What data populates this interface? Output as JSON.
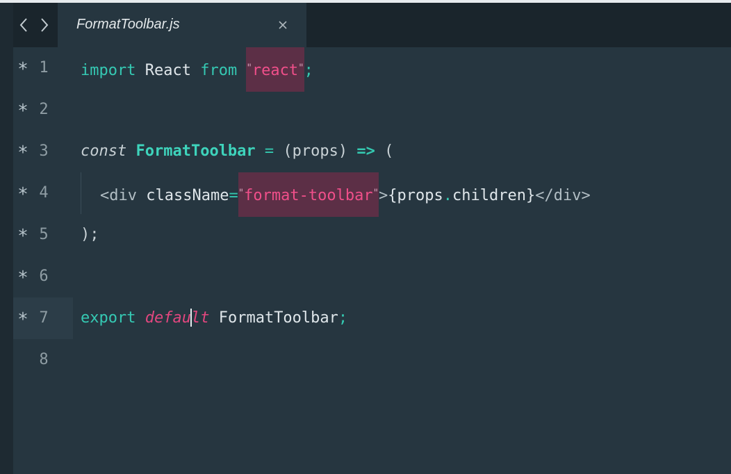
{
  "tab": {
    "title": "FormatToolbar.js"
  },
  "nav": {
    "back_icon": "chevron-left-icon",
    "forward_icon": "chevron-right-icon",
    "close_icon": "close-icon"
  },
  "modified_marker": "*",
  "lines": [
    {
      "number": "1",
      "modified": true
    },
    {
      "number": "2",
      "modified": true
    },
    {
      "number": "3",
      "modified": true
    },
    {
      "number": "4",
      "modified": true
    },
    {
      "number": "5",
      "modified": true
    },
    {
      "number": "6",
      "modified": true
    },
    {
      "number": "7",
      "modified": true
    },
    {
      "number": "8",
      "modified": false
    }
  ],
  "code": {
    "l1": {
      "import": "import",
      "react": "React",
      "from": "from",
      "string": "react",
      "semi": ";"
    },
    "l3": {
      "const": "const",
      "name": "FormatToolbar",
      "eq": "=",
      "params": "(props)",
      "arrow": "=>",
      "paren": "("
    },
    "l4": {
      "open_tag": "<div",
      "attr": "className",
      "eq": "=",
      "string": "format-toolbar",
      "close_bracket": ">",
      "expr_open": "{props",
      "dot": ".",
      "expr_close": "children}",
      "end_tag": "</div>"
    },
    "l5": {
      "text": ");"
    },
    "l7": {
      "export": "export",
      "default_a": "defau",
      "default_b": "lt",
      "name": "FormatToolbar",
      "semi": ";"
    }
  },
  "colors": {
    "background": "#263640",
    "keyword": "#35c9b3",
    "string": "#f04f8a",
    "string_highlight": "#5c2f46"
  }
}
